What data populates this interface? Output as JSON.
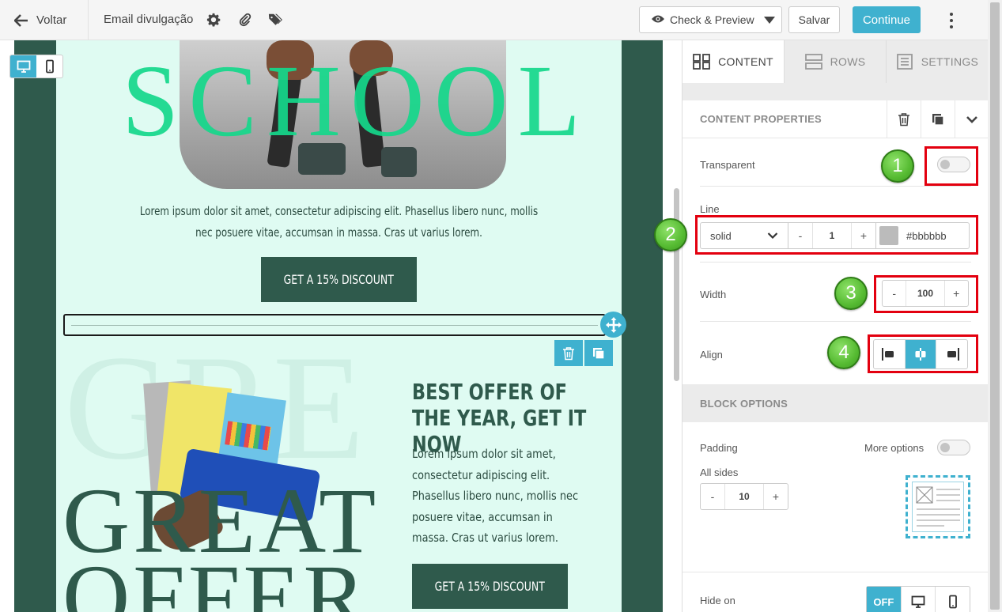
{
  "topbar": {
    "back_label": "Voltar",
    "title": "Email divulgação",
    "preview_label": "Check & Preview",
    "save_label": "Salvar",
    "continue_label": "Continue"
  },
  "email": {
    "hero_word": "SCHOOL",
    "lorem_top": "Lorem ipsum dolor sit amet, consectetur adipiscing elit. Phasellus libero nunc, mollis nec posuere vitae, accumsan in massa. Cras ut varius lorem.",
    "cta_top": "GET A 15% DISCOUNT",
    "offer_title": "BEST OFFER OF THE YEAR, GET IT NOW",
    "offer_lorem": "Lorem ipsum dolor sit amet, consectetur adipiscing elit. Phasellus libero nunc, mollis nec posuere vitae, accumsan in massa. Cras ut varius lorem.",
    "great_line1": "GREAT",
    "great_line2": "OFFER",
    "cta_bottom": "GET A 15% DISCOUNT"
  },
  "panel": {
    "tabs": [
      {
        "label": "CONTENT",
        "active": true
      },
      {
        "label": "ROWS",
        "active": false
      },
      {
        "label": "SETTINGS",
        "active": false
      }
    ],
    "content_properties": "CONTENT PROPERTIES",
    "transparent_label": "Transparent",
    "line_label": "Line",
    "line_style": "solid",
    "line_thickness": "1",
    "line_color": "#bbbbbb",
    "width_label": "Width",
    "width_value": "100",
    "align_label": "Align",
    "block_options": "BLOCK OPTIONS",
    "padding_label": "Padding",
    "more_options_label": "More options",
    "all_sides_label": "All sides",
    "padding_value": "10",
    "hide_on_label": "Hide on",
    "hide_off_label": "OFF"
  },
  "annotations": [
    "1",
    "2",
    "3",
    "4"
  ],
  "colors": {
    "accent": "#3fb1cf",
    "email_dark": "#2f5a4c",
    "email_light": "#dffbf2",
    "hero_text": "#15d88b",
    "highlight": "#e3000f",
    "badge": "#56bb32"
  }
}
